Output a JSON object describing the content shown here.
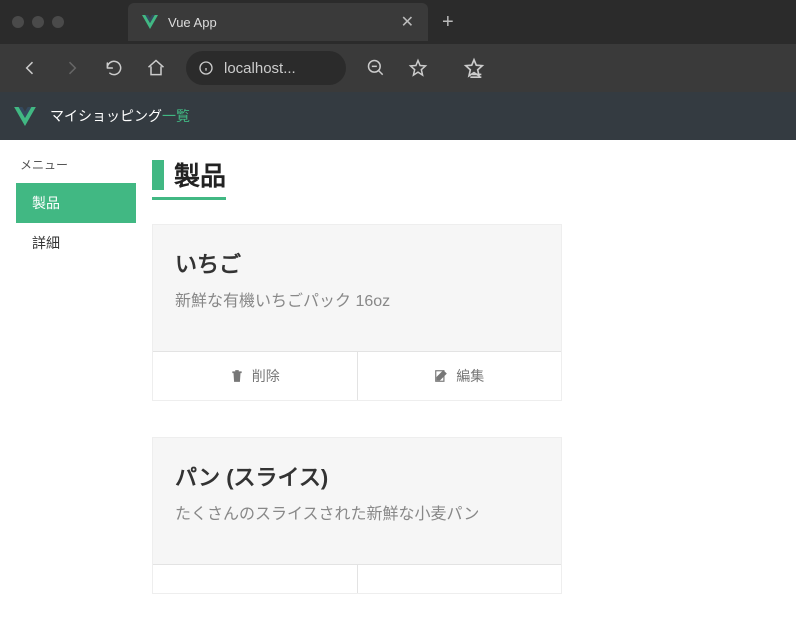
{
  "browser": {
    "tab_title": "Vue App",
    "address": "localhost..."
  },
  "app": {
    "title_prefix": "マイショッピング",
    "title_suffix": "一覧"
  },
  "sidebar": {
    "menu_label": "メニュー",
    "items": [
      {
        "label": "製品",
        "active": true
      },
      {
        "label": "詳細",
        "active": false
      }
    ]
  },
  "page": {
    "title": "製品"
  },
  "products": [
    {
      "name": "いちご",
      "description": "新鮮な有機いちごパック 16oz"
    },
    {
      "name": "パン (スライス)",
      "description": "たくさんのスライスされた新鮮な小麦パン"
    }
  ],
  "actions": {
    "delete": "削除",
    "edit": "編集"
  }
}
